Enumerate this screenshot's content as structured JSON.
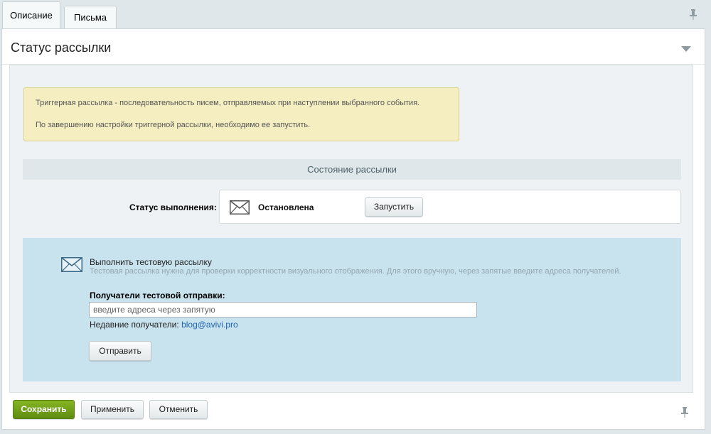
{
  "tabs": [
    {
      "label": "Описание",
      "active": true
    },
    {
      "label": "Письма",
      "active": false
    }
  ],
  "panel": {
    "title": "Статус рассылки"
  },
  "notice": {
    "line1": "Триггерная рассылка - последовательность писем, отправляемых при наступлении выбранного события.",
    "line2": "По завершению настройки триггерной рассылки, необходимо ее запустить."
  },
  "state": {
    "section_title": "Состояние рассылки",
    "status_label": "Статус выполнения:",
    "status_value": "Остановлена",
    "start_button": "Запустить",
    "icon": "envelope-icon"
  },
  "test": {
    "title": "Выполнить тестовую рассылку",
    "description": "Тестовая рассылка нужна для проверки корректности визуального отображения. Для этого вручную, через запятые введите адреса получателей.",
    "recipients_label": "Получатели тестовой отправки:",
    "recipients_placeholder": "введите адреса через запятую",
    "recipients_value": "",
    "recent_label": "Недавние получатели:",
    "recent_email": "blog@avivi.pro",
    "send_button": "Отправить",
    "icon": "envelope-icon"
  },
  "footer": {
    "save": "Сохранить",
    "apply": "Применить",
    "cancel": "Отменить"
  },
  "colors": {
    "save_button": "#6f9f1a",
    "notice_bg": "#f5eec1",
    "test_area_bg": "#c8e2ee",
    "link": "#2067b0"
  },
  "icons": [
    "pin-icon",
    "collapse-arrow-icon",
    "envelope-icon"
  ]
}
